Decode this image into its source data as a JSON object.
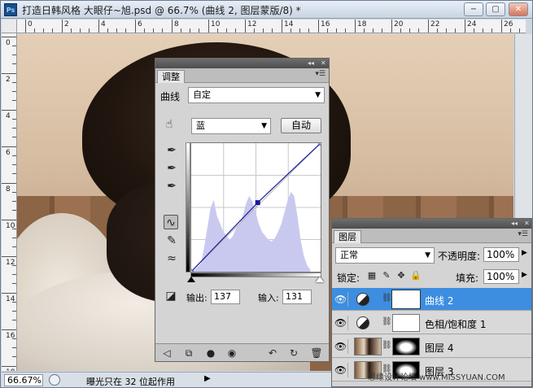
{
  "window": {
    "title": "打造日韩风格 大眼仔~旭.psd @ 66.7% (曲线 2, 图层蒙版/8) *",
    "app_icon": "Ps",
    "minimize": "−",
    "restore": "▢",
    "close": "✕"
  },
  "ruler": {
    "top_labels": [
      "0",
      "2",
      "4",
      "6",
      "8",
      "10",
      "12",
      "14",
      "16",
      "18",
      "20",
      "22",
      "24",
      "26"
    ],
    "left_labels": [
      "0",
      "2",
      "4",
      "6",
      "8",
      "10",
      "12",
      "14",
      "16",
      "18"
    ]
  },
  "status": {
    "zoom": "66.67%",
    "message": "曝光只在 32 位起作用",
    "arrow": "▶"
  },
  "adjustments": {
    "tab": "调整",
    "menu_icon": "▾☰",
    "collapse": "◂◂",
    "close": "✕",
    "preset_label": "曲线",
    "preset_value": "自定",
    "channel_value": "蓝",
    "auto_button": "自动",
    "output_label": "输出:",
    "output_value": "137",
    "input_label": "输入:",
    "input_value": "131",
    "chart_data": {
      "type": "line",
      "title": "",
      "xlabel": "",
      "ylabel": "",
      "xlim": [
        0,
        255
      ],
      "ylim": [
        0,
        255
      ],
      "points": [
        [
          0,
          0
        ],
        [
          131,
          137
        ],
        [
          255,
          255
        ]
      ],
      "line_color": "#1a1aa0"
    }
  },
  "layers": {
    "tab": "图层",
    "blend_mode": "正常",
    "opacity_label": "不透明度:",
    "opacity_value": "100%",
    "lock_label": "锁定:",
    "fill_label": "填充:",
    "fill_value": "100%",
    "items": [
      {
        "name": "曲线 2",
        "type": "adjustment",
        "selected": true
      },
      {
        "name": "色相/饱和度 1",
        "type": "adjustment",
        "selected": false
      },
      {
        "name": "图层 4",
        "type": "photo-mask",
        "selected": false
      },
      {
        "name": "图层 3",
        "type": "photo",
        "selected": false
      }
    ]
  },
  "watermark": "思缘设计论坛 www.MISSYUAN.COM"
}
